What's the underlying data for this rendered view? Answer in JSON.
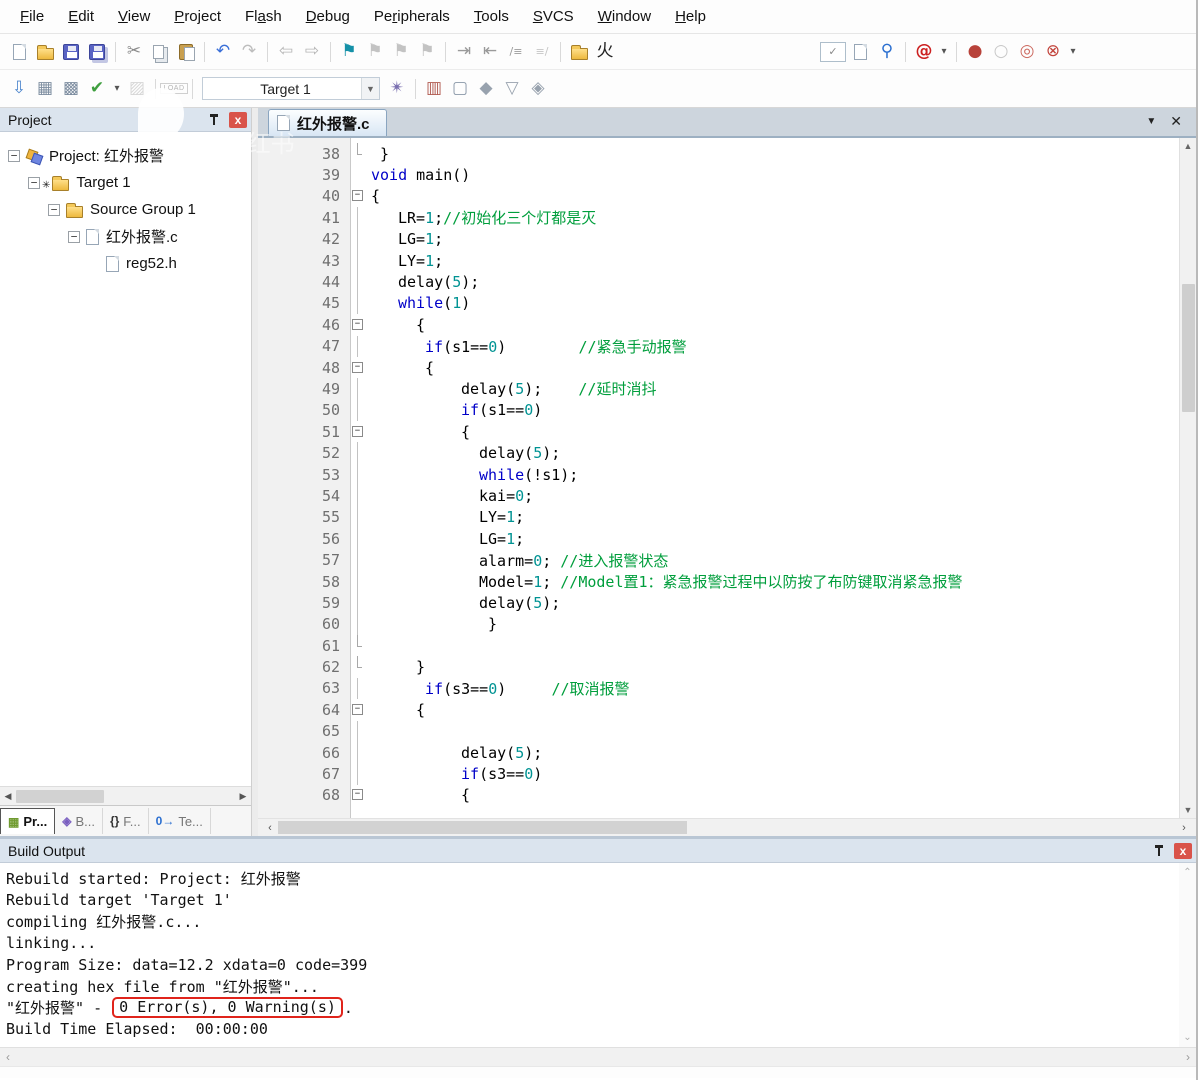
{
  "menubar": {
    "items": [
      {
        "label": "File",
        "u": 0
      },
      {
        "label": "Edit",
        "u": 0
      },
      {
        "label": "View",
        "u": 0
      },
      {
        "label": "Project",
        "u": 0
      },
      {
        "label": "Flash",
        "u": 2
      },
      {
        "label": "Debug",
        "u": 0
      },
      {
        "label": "Peripherals",
        "u": 2
      },
      {
        "label": "Tools",
        "u": 0
      },
      {
        "label": "SVCS",
        "u": 0
      },
      {
        "label": "Window",
        "u": 0
      },
      {
        "label": "Help",
        "u": 0
      }
    ]
  },
  "toolbar1": {
    "items": [
      {
        "name": "new-file-icon",
        "type": "doc"
      },
      {
        "name": "open-file-icon",
        "type": "folder"
      },
      {
        "name": "save-icon",
        "type": "save"
      },
      {
        "name": "save-all-icon",
        "type": "saveall"
      },
      {
        "sep": true
      },
      {
        "name": "cut-icon",
        "glyph": "✂",
        "color": "#8a8a8a"
      },
      {
        "name": "copy-icon",
        "type": "copy"
      },
      {
        "name": "paste-icon",
        "type": "paste"
      },
      {
        "sep": true
      },
      {
        "name": "undo-icon",
        "glyph": "↶",
        "color": "#3a6fd8"
      },
      {
        "name": "redo-icon",
        "glyph": "↷",
        "color": "#bdbdbd"
      },
      {
        "sep": true
      },
      {
        "name": "navigate-back-icon",
        "glyph": "⇦",
        "color": "#b5b5b5"
      },
      {
        "name": "navigate-forward-icon",
        "glyph": "⇨",
        "color": "#b5b5b5"
      },
      {
        "sep": true
      },
      {
        "name": "bookmark-toggle-icon",
        "glyph": "⚑",
        "color": "#1591a8"
      },
      {
        "name": "bookmark-prev-icon",
        "glyph": "⚑",
        "color": "#c3c3c3"
      },
      {
        "name": "bookmark-next-icon",
        "glyph": "⚑",
        "color": "#c3c3c3"
      },
      {
        "name": "bookmark-clear-icon",
        "glyph": "⚑",
        "color": "#c3c3c3"
      },
      {
        "sep": true
      },
      {
        "name": "indent-right-icon",
        "glyph": "⇥",
        "color": "#9a9a9a"
      },
      {
        "name": "indent-left-icon",
        "glyph": "⇤",
        "color": "#9a9a9a"
      },
      {
        "name": "comment-selection-icon",
        "glyph": "/≡",
        "color": "#9a9a9a",
        "small": true
      },
      {
        "name": "uncomment-selection-icon",
        "glyph": "≡/",
        "color": "#c6c6c6",
        "small": true
      },
      {
        "sep": true
      },
      {
        "name": "insert-template-icon",
        "type": "folder"
      },
      {
        "name": "fire-icon",
        "glyph": "火",
        "color": "#222"
      },
      {
        "spacer": true
      },
      {
        "name": "find-combobox",
        "type": "combo-small",
        "glyph": "✓"
      },
      {
        "name": "find-in-document-icon",
        "type": "docsearch"
      },
      {
        "name": "find-in-files-icon",
        "glyph": "⚲",
        "color": "#2b6fd0"
      },
      {
        "sep": true
      },
      {
        "name": "reference-search-icon",
        "glyph": "@",
        "color": "#cc2020",
        "bold": true
      },
      {
        "name": "reference-search-caret",
        "glyph": "▾",
        "color": "#555",
        "caret": true
      },
      {
        "sep": true
      },
      {
        "name": "insert-breakpoint-icon",
        "glyph": "●",
        "color": "#b8423a"
      },
      {
        "name": "enable-breakpoint-icon",
        "glyph": "○",
        "color": "#c8c8c8"
      },
      {
        "name": "disable-all-breakpoints-icon",
        "glyph": "◎",
        "color": "#cc6a60"
      },
      {
        "name": "kill-all-breakpoints-icon",
        "glyph": "⊗",
        "color": "#c2443c"
      },
      {
        "name": "breakpoint-caret",
        "glyph": "▾",
        "color": "#555",
        "caret": true
      },
      {
        "gap": true
      }
    ]
  },
  "toolbar2": {
    "target_select": "Target 1",
    "items": [
      {
        "name": "translate-file-icon",
        "glyph": "⇩",
        "color": "#4a84cc"
      },
      {
        "name": "build-target-icon",
        "glyph": "▦",
        "color": "#7d8da0"
      },
      {
        "name": "rebuild-all-icon",
        "glyph": "▩",
        "color": "#7d8da0"
      },
      {
        "name": "batch-build-icon",
        "glyph": "✔",
        "color": "#3f9f3f"
      },
      {
        "name": "batch-build-caret",
        "glyph": "▾",
        "color": "#555",
        "caret": true
      },
      {
        "name": "stop-build-icon",
        "glyph": "▨",
        "color": "#d6d6d6"
      },
      {
        "sep": true
      },
      {
        "name": "download-icon",
        "type": "load",
        "glyph": "LOAD"
      },
      {
        "sep": true
      },
      {
        "name": "target-combobox",
        "type": "combo-target"
      },
      {
        "name": "options-for-target-icon",
        "glyph": "✴",
        "color": "#7a6fb0"
      },
      {
        "sep": true
      },
      {
        "name": "run-time-environment-icon",
        "glyph": "▥",
        "color": "#b05a50"
      },
      {
        "name": "select-software-packs-icon",
        "glyph": "▢",
        "color": "#8a98a8"
      },
      {
        "name": "pack-installer-icon",
        "glyph": "◆",
        "color": "#98a2ae"
      },
      {
        "name": "filter-icon",
        "glyph": "▽",
        "color": "#98a2ae"
      },
      {
        "name": "manage-books-icon",
        "glyph": "◈",
        "color": "#98a2ae"
      }
    ]
  },
  "project_panel": {
    "title": "Project",
    "tree": [
      {
        "depth": 0,
        "minus": true,
        "icon": "proj",
        "label": "Project: 红外报警"
      },
      {
        "depth": 1,
        "minus": true,
        "icon": "folder",
        "mark": "✳",
        "label": "Target 1"
      },
      {
        "depth": 2,
        "minus": true,
        "icon": "folder",
        "label": "Source Group 1"
      },
      {
        "depth": 3,
        "minus": true,
        "icon": "doc",
        "label": "红外报警.c"
      },
      {
        "depth": 4,
        "minus": false,
        "icon": "doc",
        "label": "reg52.h"
      }
    ],
    "tabs": [
      {
        "name": "tab-project",
        "icon": "▦",
        "icon_color": "#6f9a2f",
        "label": "Pr...",
        "active": true
      },
      {
        "name": "tab-books",
        "icon": "◈",
        "icon_color": "#7a5fc0",
        "label": "B...",
        "active": false
      },
      {
        "name": "tab-functions",
        "icon": "{}",
        "icon_color": "#333",
        "label": "F...",
        "active": false
      },
      {
        "name": "tab-templates",
        "icon": "0→",
        "icon_color": "#2b6fd0",
        "label": "Te...",
        "active": false
      }
    ]
  },
  "editor": {
    "tab_label": "红外报警.c",
    "tab_list_caret": "▼",
    "close_glyph": "✕",
    "lines": [
      {
        "n": 38,
        "fold": "end",
        "ind": 1,
        "segs": [
          [
            "}",
            "p"
          ]
        ]
      },
      {
        "n": 39,
        "fold": "",
        "ind": 0,
        "segs": [
          [
            "void",
            "k"
          ],
          [
            " main()",
            "p"
          ]
        ]
      },
      {
        "n": 40,
        "fold": "box",
        "ind": 0,
        "segs": [
          [
            "{",
            "p"
          ]
        ]
      },
      {
        "n": 41,
        "fold": "line",
        "ind": 3,
        "segs": [
          [
            "LR=",
            "p"
          ],
          [
            "1",
            "n"
          ],
          [
            ";",
            "p"
          ],
          [
            "//初始化三个灯都是灭",
            "c"
          ]
        ]
      },
      {
        "n": 42,
        "fold": "line",
        "ind": 3,
        "segs": [
          [
            "LG=",
            "p"
          ],
          [
            "1",
            "n"
          ],
          [
            ";",
            "p"
          ]
        ]
      },
      {
        "n": 43,
        "fold": "line",
        "ind": 3,
        "segs": [
          [
            "LY=",
            "p"
          ],
          [
            "1",
            "n"
          ],
          [
            ";",
            "p"
          ]
        ]
      },
      {
        "n": 44,
        "fold": "line",
        "ind": 3,
        "segs": [
          [
            "delay(",
            "p"
          ],
          [
            "5",
            "n"
          ],
          [
            ");",
            "p"
          ]
        ]
      },
      {
        "n": 45,
        "fold": "line",
        "ind": 3,
        "segs": [
          [
            "while",
            "k"
          ],
          [
            "(",
            "p"
          ],
          [
            "1",
            "n"
          ],
          [
            ")",
            "p"
          ]
        ]
      },
      {
        "n": 46,
        "fold": "box",
        "ind": 5,
        "segs": [
          [
            "{",
            "p"
          ]
        ]
      },
      {
        "n": 47,
        "fold": "line",
        "ind": 6,
        "segs": [
          [
            "if",
            "k"
          ],
          [
            "(s1==",
            "p"
          ],
          [
            "0",
            "n"
          ],
          [
            ")",
            "p"
          ],
          [
            "        ",
            "p"
          ],
          [
            "//紧急手动报警",
            "c"
          ]
        ]
      },
      {
        "n": 48,
        "fold": "box",
        "ind": 6,
        "segs": [
          [
            "{",
            "p"
          ]
        ]
      },
      {
        "n": 49,
        "fold": "line",
        "ind": 10,
        "segs": [
          [
            "delay(",
            "p"
          ],
          [
            "5",
            "n"
          ],
          [
            ");",
            "p"
          ],
          [
            "    ",
            "p"
          ],
          [
            "//延时消抖",
            "c"
          ]
        ]
      },
      {
        "n": 50,
        "fold": "line",
        "ind": 10,
        "segs": [
          [
            "if",
            "k"
          ],
          [
            "(s1==",
            "p"
          ],
          [
            "0",
            "n"
          ],
          [
            ")",
            "p"
          ]
        ]
      },
      {
        "n": 51,
        "fold": "box",
        "ind": 10,
        "segs": [
          [
            "{",
            "p"
          ]
        ]
      },
      {
        "n": 52,
        "fold": "line",
        "ind": 12,
        "segs": [
          [
            "delay(",
            "p"
          ],
          [
            "5",
            "n"
          ],
          [
            ");",
            "p"
          ]
        ]
      },
      {
        "n": 53,
        "fold": "line",
        "ind": 12,
        "segs": [
          [
            "while",
            "k"
          ],
          [
            "(!s1);",
            "p"
          ]
        ]
      },
      {
        "n": 54,
        "fold": "line",
        "ind": 12,
        "segs": [
          [
            "kai=",
            "p"
          ],
          [
            "0",
            "n"
          ],
          [
            ";",
            "p"
          ]
        ]
      },
      {
        "n": 55,
        "fold": "line",
        "ind": 12,
        "segs": [
          [
            "LY=",
            "p"
          ],
          [
            "1",
            "n"
          ],
          [
            ";",
            "p"
          ]
        ]
      },
      {
        "n": 56,
        "fold": "line",
        "ind": 12,
        "segs": [
          [
            "LG=",
            "p"
          ],
          [
            "1",
            "n"
          ],
          [
            ";",
            "p"
          ]
        ]
      },
      {
        "n": 57,
        "fold": "line",
        "ind": 12,
        "segs": [
          [
            "alarm=",
            "p"
          ],
          [
            "0",
            "n"
          ],
          [
            "; ",
            "p"
          ],
          [
            "//进入报警状态",
            "c"
          ]
        ]
      },
      {
        "n": 58,
        "fold": "line",
        "ind": 12,
        "segs": [
          [
            "Model=",
            "p"
          ],
          [
            "1",
            "n"
          ],
          [
            "; ",
            "p"
          ],
          [
            "//Model置1：紧急报警过程中以防按了布防键取消紧急报警",
            "c"
          ]
        ]
      },
      {
        "n": 59,
        "fold": "line",
        "ind": 12,
        "segs": [
          [
            "delay(",
            "p"
          ],
          [
            "5",
            "n"
          ],
          [
            ");",
            "p"
          ]
        ]
      },
      {
        "n": 60,
        "fold": "line",
        "ind": 13,
        "segs": [
          [
            "}",
            "p"
          ]
        ]
      },
      {
        "n": 61,
        "fold": "end",
        "ind": 0,
        "segs": []
      },
      {
        "n": 62,
        "fold": "end",
        "ind": 5,
        "segs": [
          [
            "}",
            "p"
          ]
        ]
      },
      {
        "n": 63,
        "fold": "line",
        "ind": 6,
        "segs": [
          [
            "if",
            "k"
          ],
          [
            "(s3==",
            "p"
          ],
          [
            "0",
            "n"
          ],
          [
            ")",
            "p"
          ],
          [
            "     ",
            "p"
          ],
          [
            "//取消报警",
            "c"
          ]
        ]
      },
      {
        "n": 64,
        "fold": "box",
        "ind": 5,
        "segs": [
          [
            "{",
            "p"
          ]
        ]
      },
      {
        "n": 65,
        "fold": "line",
        "ind": 0,
        "segs": []
      },
      {
        "n": 66,
        "fold": "line",
        "ind": 10,
        "segs": [
          [
            "delay(",
            "p"
          ],
          [
            "5",
            "n"
          ],
          [
            ");",
            "p"
          ]
        ]
      },
      {
        "n": 67,
        "fold": "line",
        "ind": 10,
        "segs": [
          [
            "if",
            "k"
          ],
          [
            "(s3==",
            "p"
          ],
          [
            "0",
            "n"
          ],
          [
            ")",
            "p"
          ]
        ]
      },
      {
        "n": 68,
        "fold": "box",
        "ind": 10,
        "segs": [
          [
            "{",
            "p"
          ]
        ]
      }
    ]
  },
  "build_output": {
    "title": "Build Output",
    "lines": [
      [
        {
          "t": "Rebuild started: Project: 红外报警"
        }
      ],
      [
        {
          "t": "Rebuild target 'Target 1'"
        }
      ],
      [
        {
          "t": "compiling 红外报警.c..."
        }
      ],
      [
        {
          "t": "linking..."
        }
      ],
      [
        {
          "t": "Program Size: data=12.2 xdata=0 code=399"
        }
      ],
      [
        {
          "t": "creating hex file from \"红外报警\"..."
        }
      ],
      [
        {
          "t": "\"红外报警\" - "
        },
        {
          "t": "0 Error(s), 0 Warning(s)",
          "box": true
        },
        {
          "t": "."
        }
      ],
      [
        {
          "t": "Build Time Elapsed:  00:00:00"
        }
      ]
    ]
  },
  "watermark": {
    "text": "From 小红书"
  },
  "colors": {
    "keyword": "#0000c8",
    "number": "#009393",
    "comment": "#009e3c",
    "plain": "#000000",
    "highlight_red": "#e0241b"
  }
}
